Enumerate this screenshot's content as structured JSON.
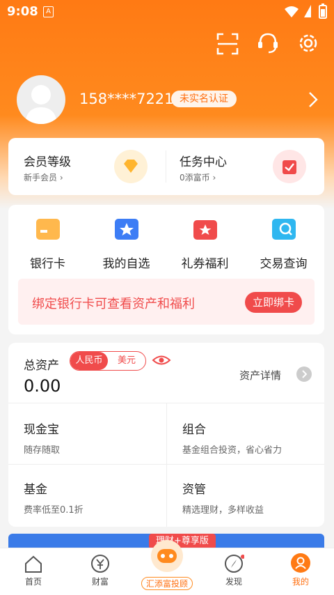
{
  "status_bar": {
    "time": "9:08",
    "sim_label": "A"
  },
  "profile": {
    "phone": "158****7221",
    "badge": "未实名认证"
  },
  "member": {
    "title": "会员等级",
    "subtitle": "新手会员 ›"
  },
  "task": {
    "title": "任务中心",
    "subtitle": "0添富币 ›"
  },
  "quick_actions": [
    {
      "label": "银行卡",
      "icon": "bank-card-icon"
    },
    {
      "label": "我的自选",
      "icon": "favorite-star-icon"
    },
    {
      "label": "礼券福利",
      "icon": "coupon-icon"
    },
    {
      "label": "交易查询",
      "icon": "search-transaction-icon"
    }
  ],
  "bind_banner": {
    "text": "绑定银行卡可查看资产和福利",
    "button": "立即绑卡"
  },
  "assets": {
    "title": "总资产",
    "currency_rmb": "人民币",
    "currency_usd": "美元",
    "amount": "0.00",
    "detail_link": "资产详情"
  },
  "products": [
    {
      "title": "现金宝",
      "desc": "随存随取"
    },
    {
      "title": "组合",
      "desc": "基金组合投资，省心省力"
    },
    {
      "title": "基金",
      "desc": "费率低至0.1折"
    },
    {
      "title": "资管",
      "desc": "精选理财，多样收益"
    }
  ],
  "promo": {
    "tag": "理财+尊享版"
  },
  "tabbar": [
    {
      "label": "首页",
      "icon": "home-icon"
    },
    {
      "label": "财富",
      "icon": "yen-icon"
    },
    {
      "label": "汇添富投顾",
      "icon": "robot-advisor-icon"
    },
    {
      "label": "发现",
      "icon": "compass-icon"
    },
    {
      "label": "我的",
      "icon": "user-icon"
    }
  ],
  "colors": {
    "brand": "#ff7a14",
    "accent_red": "#f04b4b",
    "active_tab": "#ff7a14"
  }
}
